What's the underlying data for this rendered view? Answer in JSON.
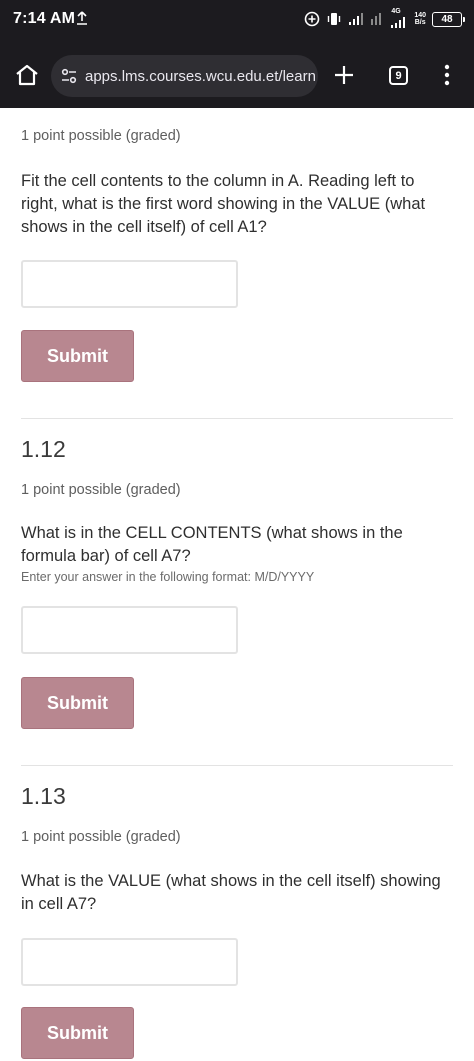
{
  "status_bar": {
    "time": "7:14 AM",
    "network_type": "4G",
    "net_speed_value": "140",
    "net_speed_unit": "B/s",
    "battery": "48",
    "icons": [
      "upload-icon",
      "add-circle-icon",
      "vibrate-icon",
      "signal-icon",
      "signal-icon",
      "signal-4g-icon",
      "battery-icon"
    ]
  },
  "browser": {
    "url": "apps.lms.courses.wcu.edu.et/learn",
    "tab_count": "9",
    "icons": [
      "home-icon",
      "site-settings-icon",
      "plus-icon",
      "tab-switcher-icon",
      "more-vert-icon"
    ]
  },
  "problems": [
    {
      "title": "",
      "points": "1 point possible (graded)",
      "question": "Fit the cell contents to the column in A. Reading left to right, what is the first word showing in the VALUE (what shows in the cell itself) of cell A1?",
      "hint": "",
      "answer_value": "",
      "submit_label": "Submit"
    },
    {
      "title": "1.12",
      "points": "1 point possible (graded)",
      "question": "What is in the CELL CONTENTS (what shows in the formula bar) of cell A7?",
      "hint": "Enter your answer in the following format: M/D/YYYY",
      "answer_value": "",
      "submit_label": "Submit"
    },
    {
      "title": "1.13",
      "points": "1 point possible (graded)",
      "question": "What is the VALUE (what shows in the cell itself) showing in cell A7?",
      "hint": "",
      "answer_value": "",
      "submit_label": "Submit"
    }
  ],
  "colors": {
    "chrome_bg": "#1c1b1f",
    "url_pill_bg": "#2f2e33",
    "submit_bg": "#b88790",
    "divider": "#e3e3e3"
  }
}
